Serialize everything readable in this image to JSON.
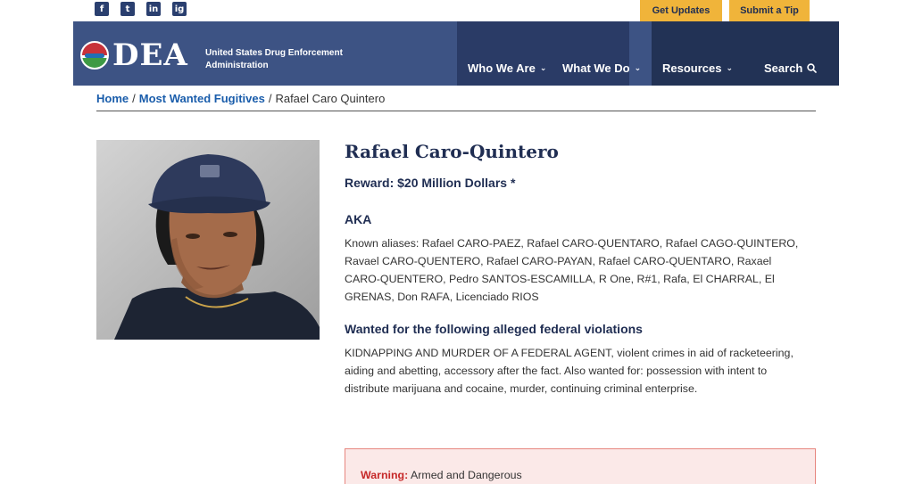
{
  "social": [
    "f",
    "t",
    "in",
    "ig"
  ],
  "top_actions": {
    "updates": "Get Updates",
    "tip": "Submit a Tip"
  },
  "logo": {
    "wordmark": "DEA",
    "subtitle": "United States Drug Enforcement Administration"
  },
  "nav": [
    {
      "label": "Who We Are",
      "icon": "chevron-down-icon"
    },
    {
      "label": "What We Do",
      "icon": "chevron-down-icon"
    },
    {
      "label": "Resources",
      "icon": "chevron-down-icon"
    },
    {
      "label": "Search",
      "icon": "search-icon"
    }
  ],
  "breadcrumb": {
    "home": "Home",
    "section": "Most Wanted Fugitives",
    "current": "Rafael Caro Quintero"
  },
  "fugitive": {
    "name": "Rafael Caro-Quintero",
    "reward": "Reward: $20 Million Dollars *",
    "aka_heading": "AKA",
    "aka_text": "Known aliases: Rafael CARO-PAEZ, Rafael CARO-QUENTARO, Rafael CAGO-QUINTERO, Ravael CARO-QUENTERO, Rafael CARO-PAYAN, Rafael CARO-QUENTARO, Raxael CARO-QUENTERO, Pedro SANTOS-ESCAMILLA, R One, R#1, Rafa, El CHARRAL, El GRENAS, Don RAFA, Licenciado RIOS",
    "violations_heading": "Wanted for the following alleged federal violations",
    "violations_text": "KIDNAPPING AND MURDER OF A FEDERAL AGENT, violent crimes in aid of racketeering, aiding and abetting, accessory after the fact. Also wanted for: possession with intent to distribute marijuana and cocaine, murder, continuing criminal enterprise."
  },
  "warning": {
    "label": "Warning:",
    "text": "Armed and Dangerous"
  },
  "colors": {
    "nav_bg": "#3d5384",
    "nav_panel": "#2a3b66",
    "accent_button": "#f0b43a",
    "heading": "#1f2d52",
    "link": "#1a5dab",
    "warning_bg": "#fbe9e8",
    "warning_border": "#e7867f",
    "warning_label": "#c62828"
  }
}
